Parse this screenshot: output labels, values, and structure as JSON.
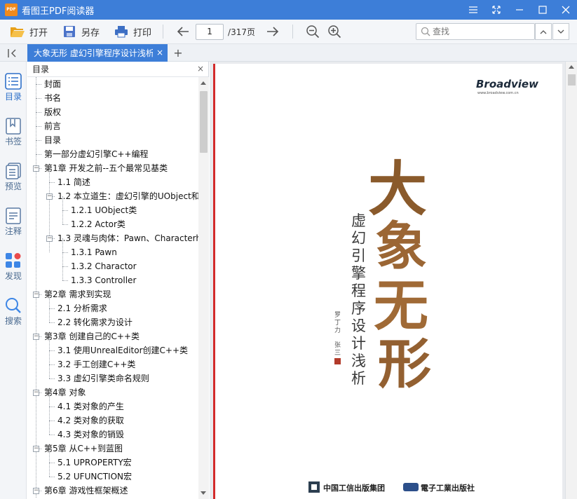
{
  "app": {
    "logo_text": "PDF",
    "title": "看图王PDF阅读器"
  },
  "toolbar": {
    "open_label": "打开",
    "save_as_label": "另存",
    "print_label": "打印",
    "current_page": "1",
    "total_pages": "/317页",
    "search_placeholder": "查找"
  },
  "tab": {
    "title": "大象无形  虚幻引擎程序设计浅析",
    "close": "×"
  },
  "rail": {
    "toc": "目录",
    "bookmarks": "书签",
    "preview": "预览",
    "annotations": "注释",
    "discover": "发现",
    "search": "搜索"
  },
  "toc": {
    "header": "目录",
    "items": [
      {
        "label": "封面"
      },
      {
        "label": "书名"
      },
      {
        "label": "版权"
      },
      {
        "label": "前言"
      },
      {
        "label": "目录"
      },
      {
        "label": "第一部分虚幻引擎C++编程"
      },
      {
        "label": "第1章 开发之前--五个最常见基类"
      },
      {
        "label": "1.1 简述"
      },
      {
        "label": "1.2 本立道生：虚幻引擎的UObject和"
      },
      {
        "label": "1.2.1 UObject类"
      },
      {
        "label": "1.2.2 Actor类"
      },
      {
        "label": "1.3 灵魂与肉体：Pawn、Characterh"
      },
      {
        "label": "1.3.1 Pawn"
      },
      {
        "label": "1.3.2 Charactor"
      },
      {
        "label": "1.3.3 Controller"
      },
      {
        "label": "第2章 需求到实现"
      },
      {
        "label": "2.1 分析需求"
      },
      {
        "label": "2.2 转化需求为设计"
      },
      {
        "label": "第3章 创建自己的C++类"
      },
      {
        "label": "3.1 使用UnrealEditor创建C++类"
      },
      {
        "label": "3.2 手工创建C++类"
      },
      {
        "label": "3.3 虚幻引擎类命名规则"
      },
      {
        "label": "第4章 对象"
      },
      {
        "label": "4.1 类对象的产生"
      },
      {
        "label": "4.2 类对象的获取"
      },
      {
        "label": "4.3 类对象的销毁"
      },
      {
        "label": "第5章 从C++到蓝图"
      },
      {
        "label": "5.1 UPROPERTY宏"
      },
      {
        "label": "5.2 UFUNCTION宏"
      },
      {
        "label": "第6章 游戏性框架概述"
      }
    ]
  },
  "cover": {
    "publisher_logo": "Broadview",
    "publisher_url": "www.broadview.com.cn",
    "title": "大象无形",
    "subtitle": "虚幻引擎程序设计浅析",
    "authors": "罗丁力  张三",
    "publisher_left": "中国工信出版集团",
    "publisher_right": "電子工業出版社"
  }
}
